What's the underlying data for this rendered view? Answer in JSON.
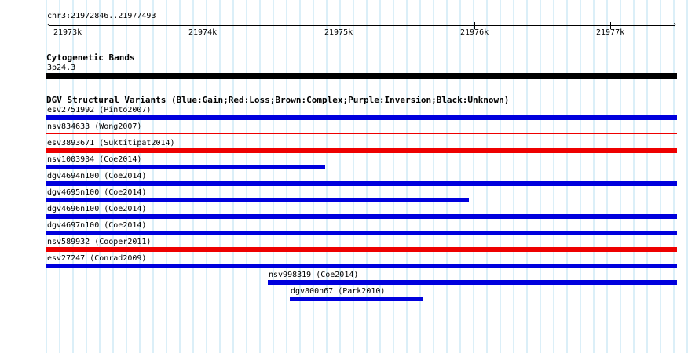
{
  "ruler": {
    "location": "chr3:21972846..21977493",
    "start": 21972846,
    "end": 21977493,
    "ticks": [
      {
        "pos": 21973000,
        "label": "21973k"
      },
      {
        "pos": 21974000,
        "label": "21974k"
      },
      {
        "pos": 21975000,
        "label": "21975k"
      },
      {
        "pos": 21976000,
        "label": "21976k"
      },
      {
        "pos": 21977000,
        "label": "21977k"
      }
    ]
  },
  "cytobands": {
    "title": "Cytogenetic Bands",
    "band_label": "3p24.3",
    "color": "#000000"
  },
  "dgv": {
    "title": "DGV Structural Variants (Blue:Gain;Red:Loss;Brown:Complex;Purple:Inversion;Black:Unknown)",
    "colors": {
      "gain": "#0000dd",
      "loss": "#ee0000",
      "complex": "#8b4513",
      "inversion": "#800080",
      "unknown": "#000000"
    },
    "variants": [
      {
        "label": "esv2751992 (Pinto2007)",
        "type": "gain",
        "start": 21972846,
        "end": 21977493,
        "thin": false
      },
      {
        "label": "nsv834633 (Wong2007)",
        "type": "loss",
        "start": 21972846,
        "end": 21977493,
        "thin": true
      },
      {
        "label": "esv3893671 (Suktitipat2014)",
        "type": "loss",
        "start": 21972846,
        "end": 21977493,
        "thin": false
      },
      {
        "label": "nsv1003934 (Coe2014)",
        "type": "gain",
        "start": 21972846,
        "end": 21974900,
        "thin": false
      },
      {
        "label": "dgv4694n100 (Coe2014)",
        "type": "gain",
        "start": 21972846,
        "end": 21977493,
        "thin": false
      },
      {
        "label": "dgv4695n100 (Coe2014)",
        "type": "gain",
        "start": 21972846,
        "end": 21975960,
        "thin": false
      },
      {
        "label": "dgv4696n100 (Coe2014)",
        "type": "gain",
        "start": 21972846,
        "end": 21977493,
        "thin": false
      },
      {
        "label": "dgv4697n100 (Coe2014)",
        "type": "gain",
        "start": 21972846,
        "end": 21977493,
        "thin": false
      },
      {
        "label": "nsv589932 (Cooper2011)",
        "type": "loss",
        "start": 21972846,
        "end": 21977493,
        "thin": false
      },
      {
        "label": "esv27247 (Conrad2009)",
        "type": "gain",
        "start": 21972846,
        "end": 21977493,
        "thin": false
      },
      {
        "label": "nsv998319 (Coe2014)",
        "type": "gain",
        "start": 21974480,
        "end": 21977493,
        "thin": false
      },
      {
        "label": "dgv800n67 (Park2010)",
        "type": "gain",
        "start": 21974640,
        "end": 21975620,
        "thin": false
      }
    ]
  }
}
